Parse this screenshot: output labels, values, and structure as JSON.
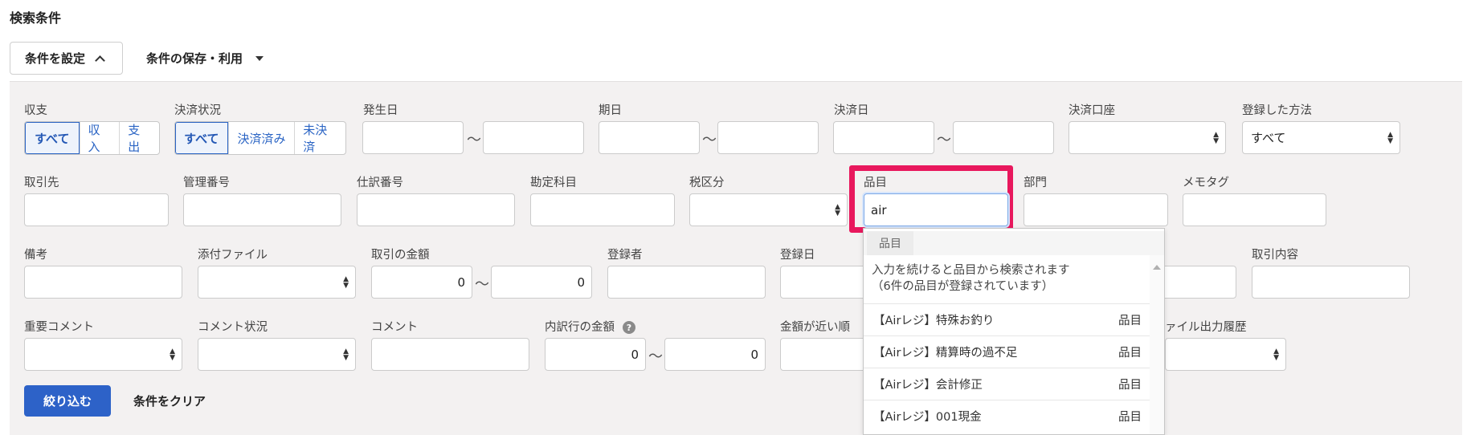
{
  "title": "検索条件",
  "toolbar": {
    "settings_label": "条件を設定",
    "save_label": "条件の保存・利用"
  },
  "row1": {
    "income": {
      "label": "収支",
      "options": [
        "すべて",
        "収入",
        "支出"
      ]
    },
    "settlement": {
      "label": "決済状況",
      "options": [
        "すべて",
        "決済済み",
        "未決済"
      ]
    },
    "issue_date": {
      "label": "発生日",
      "tilde": "〜"
    },
    "due_date": {
      "label": "期日",
      "tilde": "〜"
    },
    "settle_date": {
      "label": "決済日",
      "tilde": "〜"
    },
    "account": {
      "label": "決済口座"
    },
    "method": {
      "label": "登録した方法",
      "value": "すべて"
    }
  },
  "row2": {
    "partner": {
      "label": "取引先"
    },
    "mgmt_no": {
      "label": "管理番号"
    },
    "journal_no": {
      "label": "仕訳番号"
    },
    "account_item": {
      "label": "勘定科目"
    },
    "tax": {
      "label": "税区分"
    },
    "item": {
      "label": "品目",
      "value": "air"
    },
    "dept": {
      "label": "部門"
    },
    "memo_tag": {
      "label": "メモタグ"
    }
  },
  "row3": {
    "remarks": {
      "label": "備考"
    },
    "attachment": {
      "label": "添付ファイル"
    },
    "amount": {
      "label": "取引の金額",
      "min": "0",
      "max": "0",
      "tilde": "〜"
    },
    "registrant": {
      "label": "登録者"
    },
    "reg_date": {
      "label": "登録日"
    },
    "content": {
      "label": "取引内容"
    }
  },
  "row4": {
    "important_comment": {
      "label": "重要コメント"
    },
    "comment_status": {
      "label": "コメント状況"
    },
    "comment": {
      "label": "コメント"
    },
    "detail_amount": {
      "label": "内訳行の金額",
      "min": "0",
      "max": "0",
      "tilde": "〜",
      "help": "?"
    },
    "near_amount": {
      "label": "金額が近い順"
    },
    "file_history": {
      "label": "ァイル出力履歴"
    }
  },
  "dropdown": {
    "tab": "品目",
    "hint_line1": "入力を続けると品目から検索されます",
    "hint_line2": "（6件の品目が登録されています）",
    "items": [
      {
        "name": "【Airレジ】特殊お釣り",
        "type": "品目"
      },
      {
        "name": "【Airレジ】精算時の過不足",
        "type": "品目"
      },
      {
        "name": "【Airレジ】会計修正",
        "type": "品目"
      },
      {
        "name": "【Airレジ】001現金",
        "type": "品目"
      }
    ]
  },
  "actions": {
    "filter_label": "絞り込む",
    "clear_label": "条件をクリア"
  },
  "colors": {
    "accent": "#2d62c8",
    "highlight": "#e8185d",
    "panel": "#f3f1f1"
  }
}
